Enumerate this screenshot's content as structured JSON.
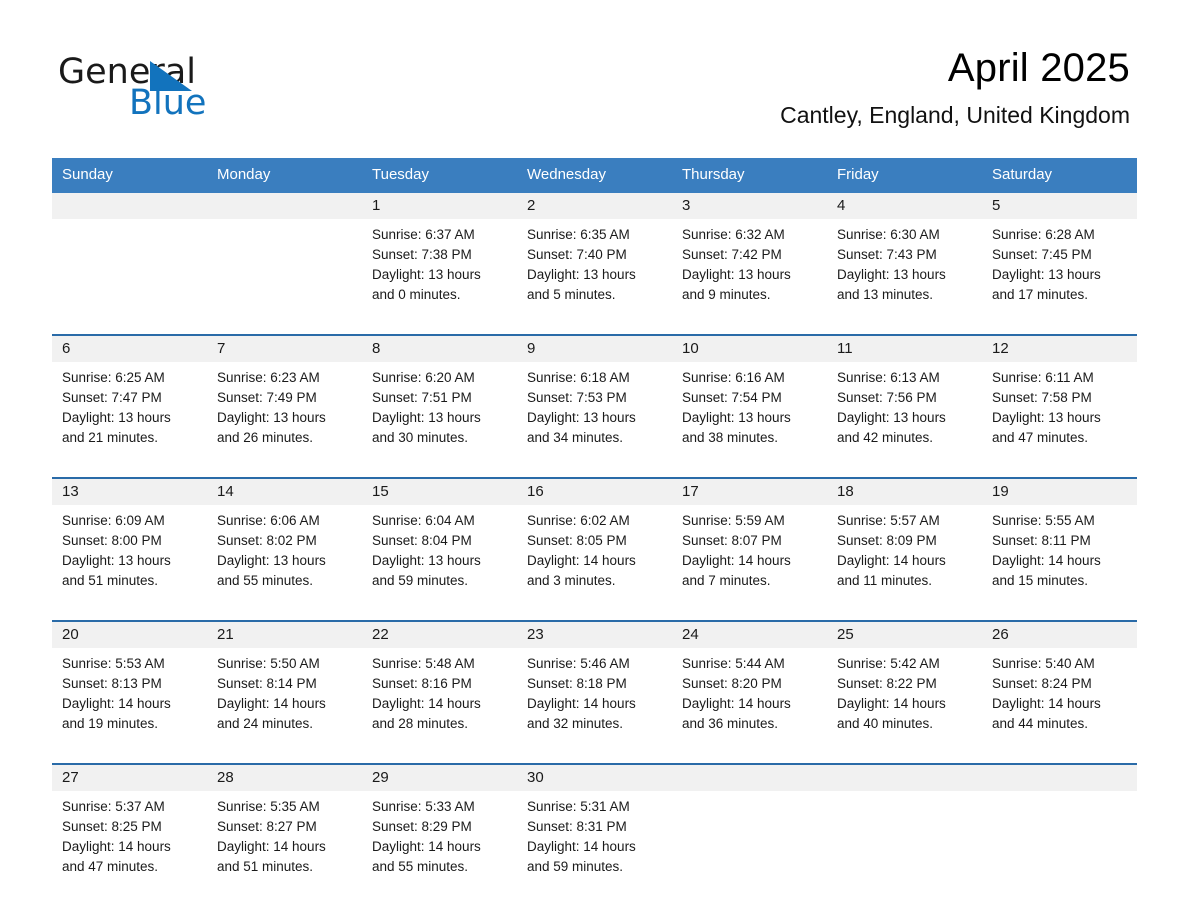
{
  "brand": {
    "name_part1": "General",
    "name_part2": "Blue",
    "accent_color": "#1273bd"
  },
  "header": {
    "title": "April 2025",
    "location": "Cantley, England, United Kingdom"
  },
  "calendar": {
    "header_bg": "#3a7ebf",
    "weekdays": [
      "Sunday",
      "Monday",
      "Tuesday",
      "Wednesday",
      "Thursday",
      "Friday",
      "Saturday"
    ],
    "weeks": [
      [
        {
          "day": "",
          "sunrise": "",
          "sunset": "",
          "daylight_line1": "",
          "daylight_line2": ""
        },
        {
          "day": "",
          "sunrise": "",
          "sunset": "",
          "daylight_line1": "",
          "daylight_line2": ""
        },
        {
          "day": "1",
          "sunrise": "Sunrise: 6:37 AM",
          "sunset": "Sunset: 7:38 PM",
          "daylight_line1": "Daylight: 13 hours",
          "daylight_line2": "and 0 minutes."
        },
        {
          "day": "2",
          "sunrise": "Sunrise: 6:35 AM",
          "sunset": "Sunset: 7:40 PM",
          "daylight_line1": "Daylight: 13 hours",
          "daylight_line2": "and 5 minutes."
        },
        {
          "day": "3",
          "sunrise": "Sunrise: 6:32 AM",
          "sunset": "Sunset: 7:42 PM",
          "daylight_line1": "Daylight: 13 hours",
          "daylight_line2": "and 9 minutes."
        },
        {
          "day": "4",
          "sunrise": "Sunrise: 6:30 AM",
          "sunset": "Sunset: 7:43 PM",
          "daylight_line1": "Daylight: 13 hours",
          "daylight_line2": "and 13 minutes."
        },
        {
          "day": "5",
          "sunrise": "Sunrise: 6:28 AM",
          "sunset": "Sunset: 7:45 PM",
          "daylight_line1": "Daylight: 13 hours",
          "daylight_line2": "and 17 minutes."
        }
      ],
      [
        {
          "day": "6",
          "sunrise": "Sunrise: 6:25 AM",
          "sunset": "Sunset: 7:47 PM",
          "daylight_line1": "Daylight: 13 hours",
          "daylight_line2": "and 21 minutes."
        },
        {
          "day": "7",
          "sunrise": "Sunrise: 6:23 AM",
          "sunset": "Sunset: 7:49 PM",
          "daylight_line1": "Daylight: 13 hours",
          "daylight_line2": "and 26 minutes."
        },
        {
          "day": "8",
          "sunrise": "Sunrise: 6:20 AM",
          "sunset": "Sunset: 7:51 PM",
          "daylight_line1": "Daylight: 13 hours",
          "daylight_line2": "and 30 minutes."
        },
        {
          "day": "9",
          "sunrise": "Sunrise: 6:18 AM",
          "sunset": "Sunset: 7:53 PM",
          "daylight_line1": "Daylight: 13 hours",
          "daylight_line2": "and 34 minutes."
        },
        {
          "day": "10",
          "sunrise": "Sunrise: 6:16 AM",
          "sunset": "Sunset: 7:54 PM",
          "daylight_line1": "Daylight: 13 hours",
          "daylight_line2": "and 38 minutes."
        },
        {
          "day": "11",
          "sunrise": "Sunrise: 6:13 AM",
          "sunset": "Sunset: 7:56 PM",
          "daylight_line1": "Daylight: 13 hours",
          "daylight_line2": "and 42 minutes."
        },
        {
          "day": "12",
          "sunrise": "Sunrise: 6:11 AM",
          "sunset": "Sunset: 7:58 PM",
          "daylight_line1": "Daylight: 13 hours",
          "daylight_line2": "and 47 minutes."
        }
      ],
      [
        {
          "day": "13",
          "sunrise": "Sunrise: 6:09 AM",
          "sunset": "Sunset: 8:00 PM",
          "daylight_line1": "Daylight: 13 hours",
          "daylight_line2": "and 51 minutes."
        },
        {
          "day": "14",
          "sunrise": "Sunrise: 6:06 AM",
          "sunset": "Sunset: 8:02 PM",
          "daylight_line1": "Daylight: 13 hours",
          "daylight_line2": "and 55 minutes."
        },
        {
          "day": "15",
          "sunrise": "Sunrise: 6:04 AM",
          "sunset": "Sunset: 8:04 PM",
          "daylight_line1": "Daylight: 13 hours",
          "daylight_line2": "and 59 minutes."
        },
        {
          "day": "16",
          "sunrise": "Sunrise: 6:02 AM",
          "sunset": "Sunset: 8:05 PM",
          "daylight_line1": "Daylight: 14 hours",
          "daylight_line2": "and 3 minutes."
        },
        {
          "day": "17",
          "sunrise": "Sunrise: 5:59 AM",
          "sunset": "Sunset: 8:07 PM",
          "daylight_line1": "Daylight: 14 hours",
          "daylight_line2": "and 7 minutes."
        },
        {
          "day": "18",
          "sunrise": "Sunrise: 5:57 AM",
          "sunset": "Sunset: 8:09 PM",
          "daylight_line1": "Daylight: 14 hours",
          "daylight_line2": "and 11 minutes."
        },
        {
          "day": "19",
          "sunrise": "Sunrise: 5:55 AM",
          "sunset": "Sunset: 8:11 PM",
          "daylight_line1": "Daylight: 14 hours",
          "daylight_line2": "and 15 minutes."
        }
      ],
      [
        {
          "day": "20",
          "sunrise": "Sunrise: 5:53 AM",
          "sunset": "Sunset: 8:13 PM",
          "daylight_line1": "Daylight: 14 hours",
          "daylight_line2": "and 19 minutes."
        },
        {
          "day": "21",
          "sunrise": "Sunrise: 5:50 AM",
          "sunset": "Sunset: 8:14 PM",
          "daylight_line1": "Daylight: 14 hours",
          "daylight_line2": "and 24 minutes."
        },
        {
          "day": "22",
          "sunrise": "Sunrise: 5:48 AM",
          "sunset": "Sunset: 8:16 PM",
          "daylight_line1": "Daylight: 14 hours",
          "daylight_line2": "and 28 minutes."
        },
        {
          "day": "23",
          "sunrise": "Sunrise: 5:46 AM",
          "sunset": "Sunset: 8:18 PM",
          "daylight_line1": "Daylight: 14 hours",
          "daylight_line2": "and 32 minutes."
        },
        {
          "day": "24",
          "sunrise": "Sunrise: 5:44 AM",
          "sunset": "Sunset: 8:20 PM",
          "daylight_line1": "Daylight: 14 hours",
          "daylight_line2": "and 36 minutes."
        },
        {
          "day": "25",
          "sunrise": "Sunrise: 5:42 AM",
          "sunset": "Sunset: 8:22 PM",
          "daylight_line1": "Daylight: 14 hours",
          "daylight_line2": "and 40 minutes."
        },
        {
          "day": "26",
          "sunrise": "Sunrise: 5:40 AM",
          "sunset": "Sunset: 8:24 PM",
          "daylight_line1": "Daylight: 14 hours",
          "daylight_line2": "and 44 minutes."
        }
      ],
      [
        {
          "day": "27",
          "sunrise": "Sunrise: 5:37 AM",
          "sunset": "Sunset: 8:25 PM",
          "daylight_line1": "Daylight: 14 hours",
          "daylight_line2": "and 47 minutes."
        },
        {
          "day": "28",
          "sunrise": "Sunrise: 5:35 AM",
          "sunset": "Sunset: 8:27 PM",
          "daylight_line1": "Daylight: 14 hours",
          "daylight_line2": "and 51 minutes."
        },
        {
          "day": "29",
          "sunrise": "Sunrise: 5:33 AM",
          "sunset": "Sunset: 8:29 PM",
          "daylight_line1": "Daylight: 14 hours",
          "daylight_line2": "and 55 minutes."
        },
        {
          "day": "30",
          "sunrise": "Sunrise: 5:31 AM",
          "sunset": "Sunset: 8:31 PM",
          "daylight_line1": "Daylight: 14 hours",
          "daylight_line2": "and 59 minutes."
        },
        {
          "day": "",
          "sunrise": "",
          "sunset": "",
          "daylight_line1": "",
          "daylight_line2": ""
        },
        {
          "day": "",
          "sunrise": "",
          "sunset": "",
          "daylight_line1": "",
          "daylight_line2": ""
        },
        {
          "day": "",
          "sunrise": "",
          "sunset": "",
          "daylight_line1": "",
          "daylight_line2": ""
        }
      ]
    ]
  }
}
